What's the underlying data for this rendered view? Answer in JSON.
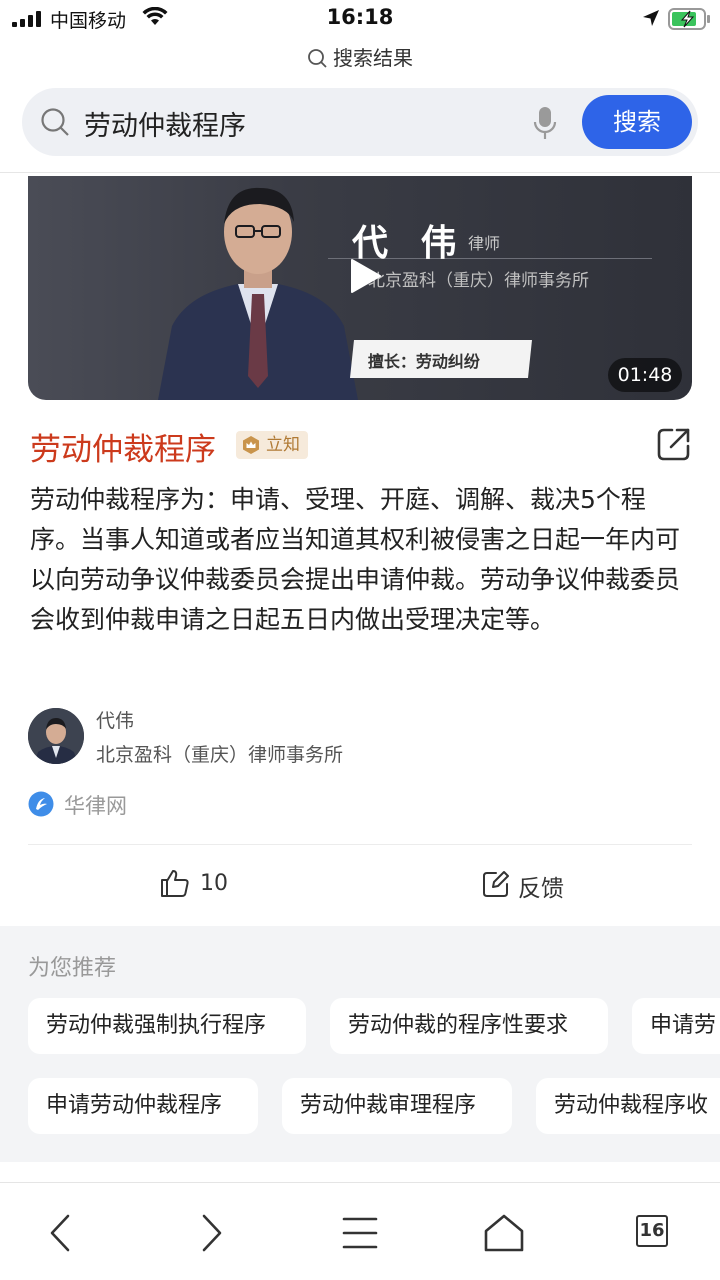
{
  "status_bar": {
    "carrier": "中国移动",
    "time": "16:18"
  },
  "page": {
    "title": "搜索结果"
  },
  "search": {
    "query": "劳动仲裁程序",
    "button_label": "搜索"
  },
  "video": {
    "lawyer_name": "代 伟",
    "lawyer_title": "律师",
    "firm": "北京盈科（重庆）律师事务所",
    "specialty": "擅长：劳动纠纷",
    "duration": "01:48"
  },
  "result": {
    "title": "劳动仲裁程序",
    "badge": "立知",
    "answer": "劳动仲裁程序为：申请、受理、开庭、调解、裁决5个程序。当事人知道或者应当知道其权利被侵害之日起一年内可以向劳动争议仲裁委员会提出申请仲裁。劳动争议仲裁委员会收到仲裁申请之日起五日内做出受理决定等。",
    "author_name": "代伟",
    "author_firm": "北京盈科（重庆）律师事务所",
    "source": "华律网"
  },
  "actions": {
    "like_count": "10",
    "feedback_label": "反馈"
  },
  "recommendations": {
    "title": "为您推荐",
    "items": [
      "劳动仲裁强制执行程序",
      "劳动仲裁的程序性要求",
      "申请劳",
      "申请劳动仲裁程序",
      "劳动仲裁审理程序",
      "劳动仲裁程序收"
    ]
  },
  "bottom_nav": {
    "tab_count": "16"
  },
  "colors": {
    "accent_blue": "#2e64e8",
    "title_red": "#cc3a1c",
    "badge_gold": "#b07a34"
  }
}
